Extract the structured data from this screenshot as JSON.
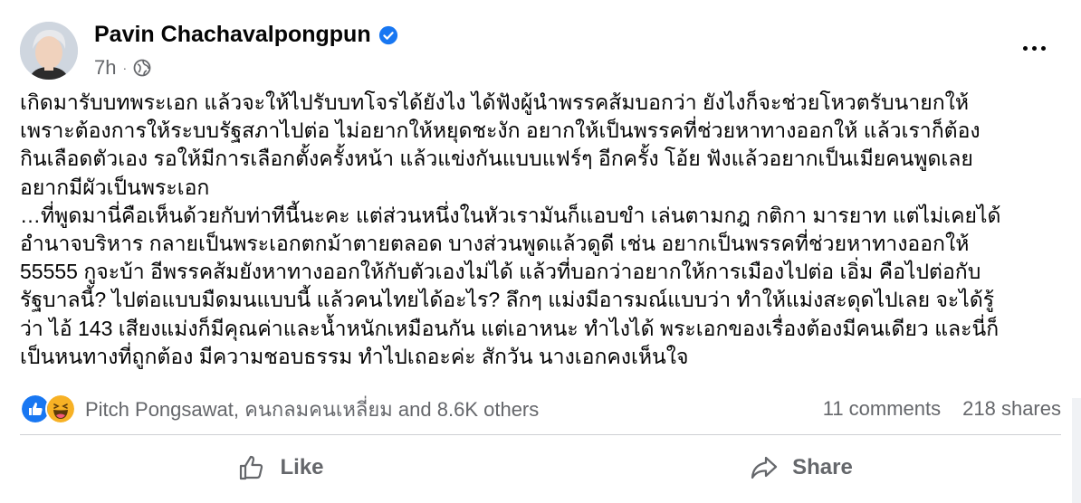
{
  "post": {
    "author": "Pavin Chachavalpongpun",
    "time": "7h",
    "dot": "·",
    "text": "เกิดมารับบทพระเอก แล้วจะให้ไปรับบทโจรได้ยังไง ได้ฟังผู้นำพรรคส้มบอกว่า ยังไงก็จะช่วยโหวตรับนายกให้\nเพราะต้องการให้ระบบรัฐสภาไปต่อ ไม่อยากให้หยุดชะงัก อยากให้เป็นพรรคที่ช่วยหาทางออกให้ แล้วเราก็ต้อง\nกินเลือดตัวเอง รอให้มีการเลือกตั้งครั้งหน้า แล้วแข่งกันแบบแฟร์ๆ อีกครั้ง โอ้ย ฟังแล้วอยากเป็นเมียคนพูดเลย\nอยากมีผัวเป็นพระเอก\n…ที่พูดมานี่คือเห็นด้วยกับท่าทีนี้นะคะ แต่ส่วนหนึ่งในหัวเรามันก็แอบขำ เล่นตามกฎ กติกา มารยาท แต่ไม่เคยได้\nอำนาจบริหาร กลายเป็นพระเอกตกม้าตายตลอด บางส่วนพูดแล้วดูดี เช่น อยากเป็นพรรคที่ช่วยหาทางออกให้\n55555 กูจะบ้า อีพรรคส้มยังหาทางออกให้กับตัวเองไม่ได้ แล้วที่บอกว่าอยากให้การเมืองไปต่อ เอิ่ม คือไปต่อกับ\nรัฐบาลนี้? ไปต่อแบบมืดมนแบบนี้ แล้วคนไทยได้อะไร? ลึกๆ แม่งมีอารมณ์แบบว่า ทำให้แม่งสะดุดไปเลย จะได้รู้\nว่า ไอ้ 143 เสียงแม่งก็มีคุณค่าและน้ำหนักเหมือนกัน แต่เอาหนะ ทำไงได้ พระเอกของเรื่องต้องมีคนเดียว และนี่ก็\nเป็นหนทางที่ถูกต้อง มีความชอบธรรม ทำไปเถอะค่ะ สักวัน นางเอกคงเห็นใจ"
  },
  "reactions": {
    "names": "Pitch Pongsawat, คนกลมคนเหลี่ยม and 8.6K others",
    "comments": "11 comments",
    "shares": "218 shares"
  },
  "actions": {
    "like": "Like",
    "share": "Share"
  },
  "colors": {
    "verified": "#1877f2",
    "like_reaction": "#1877f2",
    "haha_reaction": "#f7b125",
    "secondary_text": "#65676b"
  },
  "icons": {
    "verified": "verified-badge-icon",
    "privacy": "globe-icon",
    "more": "more-options-icon",
    "like_reaction": "thumbs-up-reaction-icon",
    "haha_reaction": "haha-reaction-icon",
    "like_action": "thumbs-up-icon",
    "share_action": "share-arrow-icon"
  }
}
